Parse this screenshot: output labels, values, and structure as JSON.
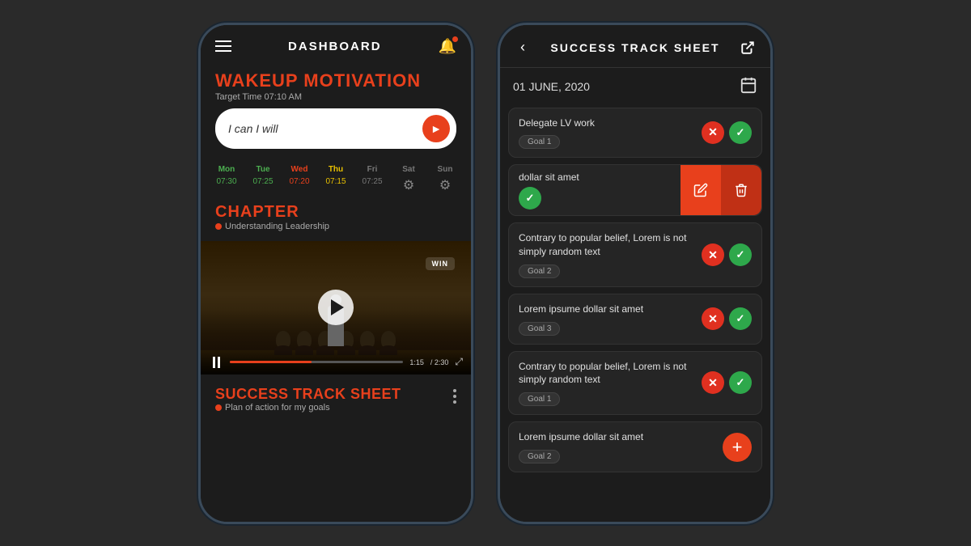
{
  "background_color": "#2a2a2a",
  "left_phone": {
    "header": {
      "title": "DASHBOARD",
      "bell_has_badge": true
    },
    "wakeup": {
      "title": "WAKEUP MOTIVATION",
      "subtitle": "Target Time 07:10 AM",
      "input_placeholder": "I can I will",
      "input_value": "I can I will"
    },
    "days": [
      {
        "label": "Mon",
        "time": "07:30",
        "style": "green",
        "label_style": "active-mon"
      },
      {
        "label": "Tue",
        "time": "07:25",
        "style": "green",
        "label_style": "active-tue"
      },
      {
        "label": "Wed",
        "time": "07:20",
        "style": "orange",
        "label_style": "active-wed"
      },
      {
        "label": "Thu",
        "time": "07:15",
        "style": "yellow",
        "label_style": "active-thu"
      },
      {
        "label": "Fri",
        "time": "07:25",
        "style": "gray",
        "label_style": "inactive",
        "is_icon": false
      },
      {
        "label": "Sat",
        "style": "gray",
        "label_style": "inactive",
        "is_icon": true
      },
      {
        "label": "Sun",
        "style": "gray",
        "label_style": "inactive",
        "is_icon": true
      }
    ],
    "chapter": {
      "title": "CHAPTER",
      "subtitle": "Understanding Leadership"
    },
    "video": {
      "current_time": "1:15",
      "total_time": "2:30",
      "progress_percent": 47,
      "win_label": "WIN"
    },
    "success": {
      "title": "SUCCESS TRACK SHEET",
      "subtitle": "Plan of action for my goals"
    }
  },
  "right_phone": {
    "header": {
      "title": "SUCCESS TRACK SHEET"
    },
    "date": "01 JUNE, 2020",
    "items": [
      {
        "id": 1,
        "text": "Delegate LV work",
        "goal": "Goal 1",
        "has_x": true,
        "has_check": true,
        "swiped": false,
        "is_add": false
      },
      {
        "id": 2,
        "text": "dollar sit amet",
        "goal": "",
        "has_x": false,
        "has_check": true,
        "swiped": true,
        "is_add": false
      },
      {
        "id": 3,
        "text": "Contrary to popular belief, Lorem is not simply random text",
        "goal": "Goal 2",
        "has_x": true,
        "has_check": true,
        "swiped": false,
        "is_add": false
      },
      {
        "id": 4,
        "text": "Lorem ipsume dollar sit amet",
        "goal": "Goal 3",
        "has_x": true,
        "has_check": true,
        "swiped": false,
        "is_add": false
      },
      {
        "id": 5,
        "text": "Contrary to popular belief, Lorem is not simply random text",
        "goal": "Goal 1",
        "has_x": true,
        "has_check": true,
        "swiped": false,
        "is_add": false
      },
      {
        "id": 6,
        "text": "Lorem ipsume dollar sit amet",
        "goal": "Goal 2",
        "has_x": false,
        "has_check": false,
        "swiped": false,
        "is_add": true
      }
    ],
    "swipe_edit_icon": "✏",
    "swipe_delete_icon": "🗑",
    "add_icon": "+"
  }
}
